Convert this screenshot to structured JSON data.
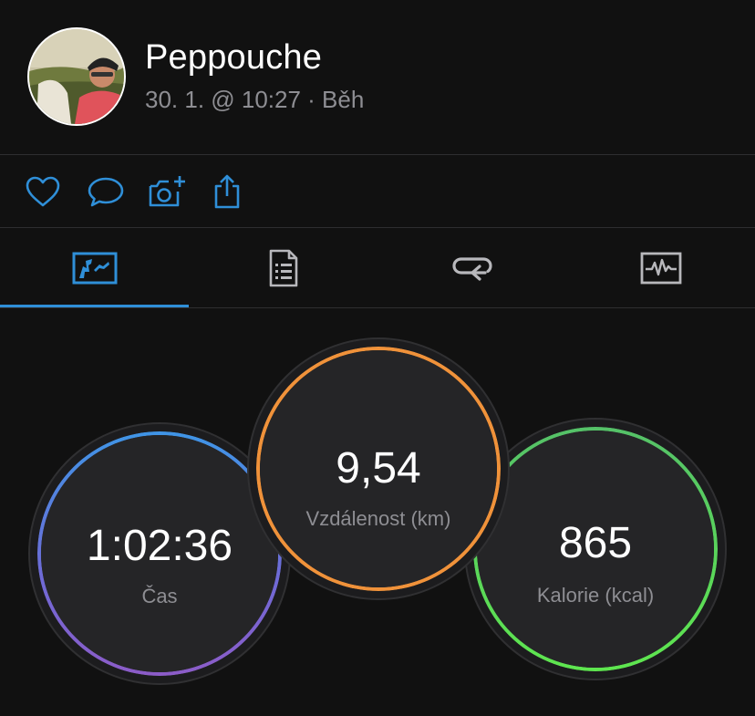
{
  "user": {
    "name": "Peppouche",
    "meta": "30. 1. @ 10:27 · Běh"
  },
  "actions": {
    "icons": [
      "heart-icon",
      "comment-icon",
      "add-photo-icon",
      "share-icon"
    ],
    "accent": "#2f8fd8"
  },
  "tabs": {
    "icons": [
      "overview-icon",
      "details-icon",
      "laps-icon",
      "charts-icon"
    ],
    "active_index": 0
  },
  "stats": {
    "time": {
      "value": "1:02:36",
      "label": "Čas"
    },
    "distance": {
      "value": "9,54",
      "label": "Vzdálenost (km)"
    },
    "calories": {
      "value": "865",
      "label": "Kalorie (kcal)"
    }
  },
  "colors": {
    "background": "#111111",
    "time_ring": "#3f95e6",
    "distance_ring": "#f0923a",
    "calories_ring": "#5ee64f",
    "label_gray": "#8e8e93"
  }
}
